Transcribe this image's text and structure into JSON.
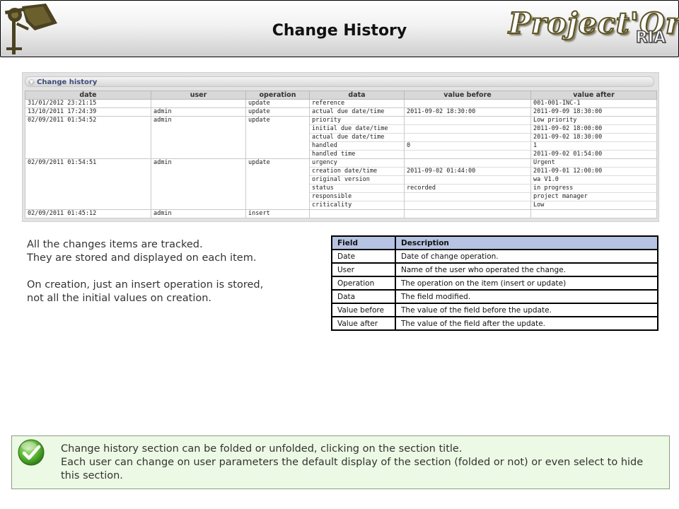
{
  "header": {
    "title": "Change History",
    "brand_main": "Project'Or",
    "brand_sub": "RIA"
  },
  "section": {
    "title": "Change history",
    "columns": [
      "date",
      "user",
      "operation",
      "data",
      "value before",
      "value after"
    ],
    "rows": [
      {
        "date": "31/01/2012 23:21:15",
        "user": "",
        "operation": "update",
        "data": "reference",
        "before": "",
        "after": "001-001-INC-1"
      },
      {
        "date": "13/10/2011 17:24:39",
        "user": "admin",
        "operation": "update",
        "data": "actual due date/time",
        "before": "2011-09-02 18:30:00",
        "after": "2011-09-09 18:30:00"
      },
      {
        "date": "02/09/2011 01:54:52",
        "user": "admin",
        "operation": "update",
        "data": "priority",
        "before": "",
        "after": "Low priority"
      },
      {
        "date": "",
        "user": "",
        "operation": "",
        "data": "initial due date/time",
        "before": "",
        "after": "2011-09-02 18:00:00"
      },
      {
        "date": "",
        "user": "",
        "operation": "",
        "data": "actual due date/time",
        "before": "",
        "after": "2011-09-02 18:30:00"
      },
      {
        "date": "",
        "user": "",
        "operation": "",
        "data": "handled",
        "before": "0",
        "after": "1"
      },
      {
        "date": "",
        "user": "",
        "operation": "",
        "data": "handled time",
        "before": "",
        "after": "2011-09-02 01:54:00"
      },
      {
        "date": "02/09/2011 01:54:51",
        "user": "admin",
        "operation": "update",
        "data": "urgency",
        "before": "",
        "after": "Urgent"
      },
      {
        "date": "",
        "user": "",
        "operation": "",
        "data": "creation date/time",
        "before": "2011-09-02 01:44:00",
        "after": "2011-09-01 12:00:00"
      },
      {
        "date": "",
        "user": "",
        "operation": "",
        "data": "original version",
        "before": "",
        "after": "wa V1.0"
      },
      {
        "date": "",
        "user": "",
        "operation": "",
        "data": "status",
        "before": "recorded",
        "after": "in progress"
      },
      {
        "date": "",
        "user": "",
        "operation": "",
        "data": "responsible",
        "before": "",
        "after": "project manager"
      },
      {
        "date": "",
        "user": "",
        "operation": "",
        "data": "criticality",
        "before": "",
        "after": "Low"
      },
      {
        "date": "02/09/2011 01:45:12",
        "user": "admin",
        "operation": "insert",
        "data": "",
        "before": "",
        "after": ""
      }
    ]
  },
  "description": {
    "line1": "All the changes items are tracked.",
    "line2": "They are stored and displayed on each item.",
    "line3": "On creation, just an insert operation is stored,",
    "line4": "not all the initial values on creation."
  },
  "fields_table": {
    "headers": [
      "Field",
      "Description"
    ],
    "rows": [
      [
        "Date",
        "Date of change operation."
      ],
      [
        "User",
        "Name of the user who operated the change."
      ],
      [
        "Operation",
        "The operation on the item (insert or update)"
      ],
      [
        "Data",
        "The field modified."
      ],
      [
        "Value before",
        "The value of the field before the update."
      ],
      [
        "Value after",
        "The value of the field after the update."
      ]
    ]
  },
  "note": {
    "line1": "Change history section can be folded or unfolded, clicking on the section title.",
    "line2": "Each user can change on user parameters the default display of the section (folded or not) or even select to hide this section."
  },
  "icons": {
    "logo": "projector-logo-icon",
    "toggle": "collapse-toggle-icon",
    "note": "green-check-icon"
  },
  "colors": {
    "section_title": "#3b4b78",
    "fields_header_bg": "#b6c3e2",
    "note_bg": "#ecf9e4"
  }
}
